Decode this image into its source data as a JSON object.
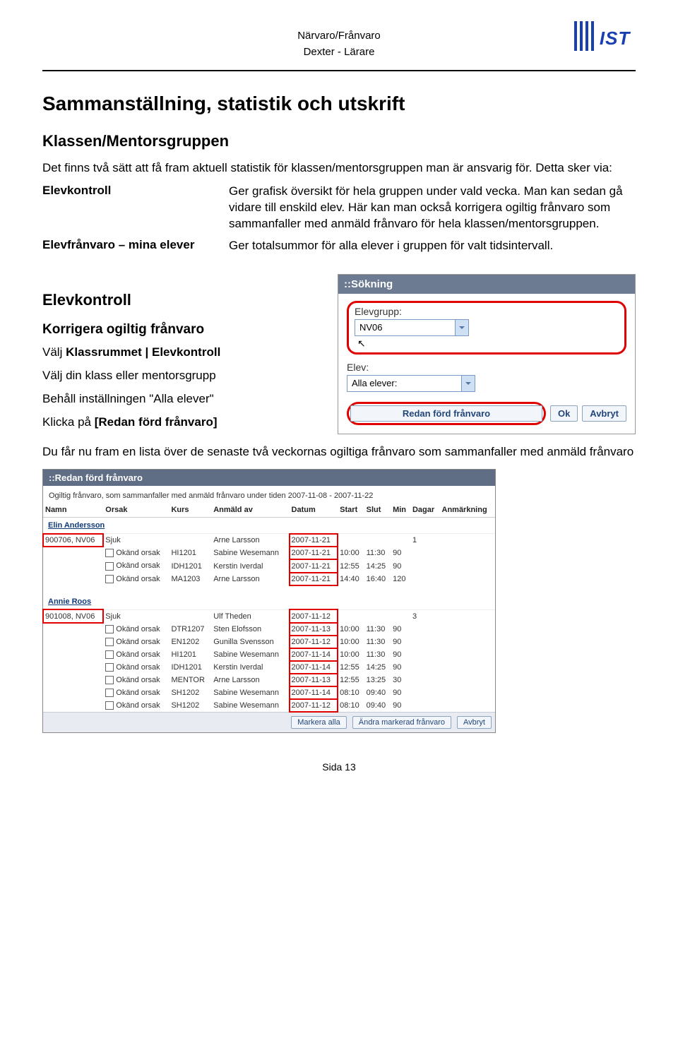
{
  "header": {
    "line1": "Närvaro/Frånvaro",
    "line2": "Dexter - Lärare",
    "logo_text": "IST"
  },
  "h1": "Sammanställning, statistik och utskrift",
  "h2_class": "Klassen/Mentorsgruppen",
  "intro": "Det finns två sätt att få fram aktuell statistik för klassen/mentorsgruppen man är ansvarig för. Detta sker via:",
  "defs": [
    {
      "term": "Elevkontroll",
      "desc": "Ger grafisk översikt för hela gruppen under vald vecka. Man kan sedan gå vidare till enskild elev. Här kan man också korrigera ogiltig frånvaro som sammanfaller med anmäld frånvaro för hela klassen/mentorsgruppen."
    },
    {
      "term": "Elevfrånvaro – mina elever",
      "desc": "Ger totalsummor för alla elever i gruppen för valt tidsintervall."
    }
  ],
  "h2_elevkontroll": "Elevkontroll",
  "h3_korrigera": "Korrigera ogiltig frånvaro",
  "steps": {
    "s1a": "Välj ",
    "s1b": "Klassrummet | Elevkontroll",
    "s2": "Välj din klass eller mentorsgrupp",
    "s3": "Behåll inställningen \"Alla elever\"",
    "s4a": "Klicka på ",
    "s4b": "[Redan förd frånvaro]",
    "s5": "Du får nu fram en lista över de senaste två veckornas ogiltiga frånvaro som sammanfaller med anmäld frånvaro"
  },
  "shot1": {
    "title": "::Sökning",
    "elevgrupp_label": "Elevgrupp:",
    "elevgrupp_value": "NV06",
    "elev_label": "Elev:",
    "elev_value": "Alla elever:",
    "btn_redan": "Redan förd frånvaro",
    "btn_ok": "Ok",
    "btn_avbryt": "Avbryt"
  },
  "shot2": {
    "title": "::Redan förd frånvaro",
    "desc": "Ogiltig frånvaro, som sammanfaller med anmäld frånvaro under tiden 2007-11-08 - 2007-11-22",
    "headers": [
      "Namn",
      "Orsak",
      "Kurs",
      "Anmäld av",
      "Datum",
      "Start",
      "Slut",
      "Min",
      "Dagar",
      "Anmärkning"
    ],
    "group1_name": "Elin Andersson",
    "group1_main": {
      "namn": "900706, NV06",
      "orsak": "Sjuk",
      "anmald": "Arne Larsson",
      "datum": "2007-11-21",
      "dagar": "1"
    },
    "group1_rows": [
      {
        "orsak": "Okänd orsak",
        "kurs": "HI1201",
        "anmald": "Sabine Wesemann",
        "datum": "2007-11-21",
        "start": "10:00",
        "slut": "11:30",
        "min": "90"
      },
      {
        "orsak": "Okänd orsak",
        "kurs": "IDH1201",
        "anmald": "Kerstin Iverdal",
        "datum": "2007-11-21",
        "start": "12:55",
        "slut": "14:25",
        "min": "90"
      },
      {
        "orsak": "Okänd orsak",
        "kurs": "MA1203",
        "anmald": "Arne Larsson",
        "datum": "2007-11-21",
        "start": "14:40",
        "slut": "16:40",
        "min": "120"
      }
    ],
    "group2_name": "Annie Roos",
    "group2_main": {
      "namn": "901008, NV06",
      "orsak": "Sjuk",
      "anmald": "Ulf Theden",
      "datum": "2007-11-12",
      "dagar": "3"
    },
    "group2_rows": [
      {
        "orsak": "Okänd orsak",
        "kurs": "DTR1207",
        "anmald": "Sten Elofsson",
        "datum": "2007-11-13",
        "start": "10:00",
        "slut": "11:30",
        "min": "90"
      },
      {
        "orsak": "Okänd orsak",
        "kurs": "EN1202",
        "anmald": "Gunilla Svensson",
        "datum": "2007-11-12",
        "start": "10:00",
        "slut": "11:30",
        "min": "90"
      },
      {
        "orsak": "Okänd orsak",
        "kurs": "HI1201",
        "anmald": "Sabine Wesemann",
        "datum": "2007-11-14",
        "start": "10:00",
        "slut": "11:30",
        "min": "90"
      },
      {
        "orsak": "Okänd orsak",
        "kurs": "IDH1201",
        "anmald": "Kerstin Iverdal",
        "datum": "2007-11-14",
        "start": "12:55",
        "slut": "14:25",
        "min": "90"
      },
      {
        "orsak": "Okänd orsak",
        "kurs": "MENTOR",
        "anmald": "Arne Larsson",
        "datum": "2007-11-13",
        "start": "12:55",
        "slut": "13:25",
        "min": "30"
      },
      {
        "orsak": "Okänd orsak",
        "kurs": "SH1202",
        "anmald": "Sabine Wesemann",
        "datum": "2007-11-14",
        "start": "08:10",
        "slut": "09:40",
        "min": "90"
      },
      {
        "orsak": "Okänd orsak",
        "kurs": "SH1202",
        "anmald": "Sabine Wesemann",
        "datum": "2007-11-12",
        "start": "08:10",
        "slut": "09:40",
        "min": "90"
      }
    ],
    "btn_markera": "Markera alla",
    "btn_andra": "Ändra markerad frånvaro",
    "btn_avbryt": "Avbryt"
  },
  "footer": "Sida 13"
}
